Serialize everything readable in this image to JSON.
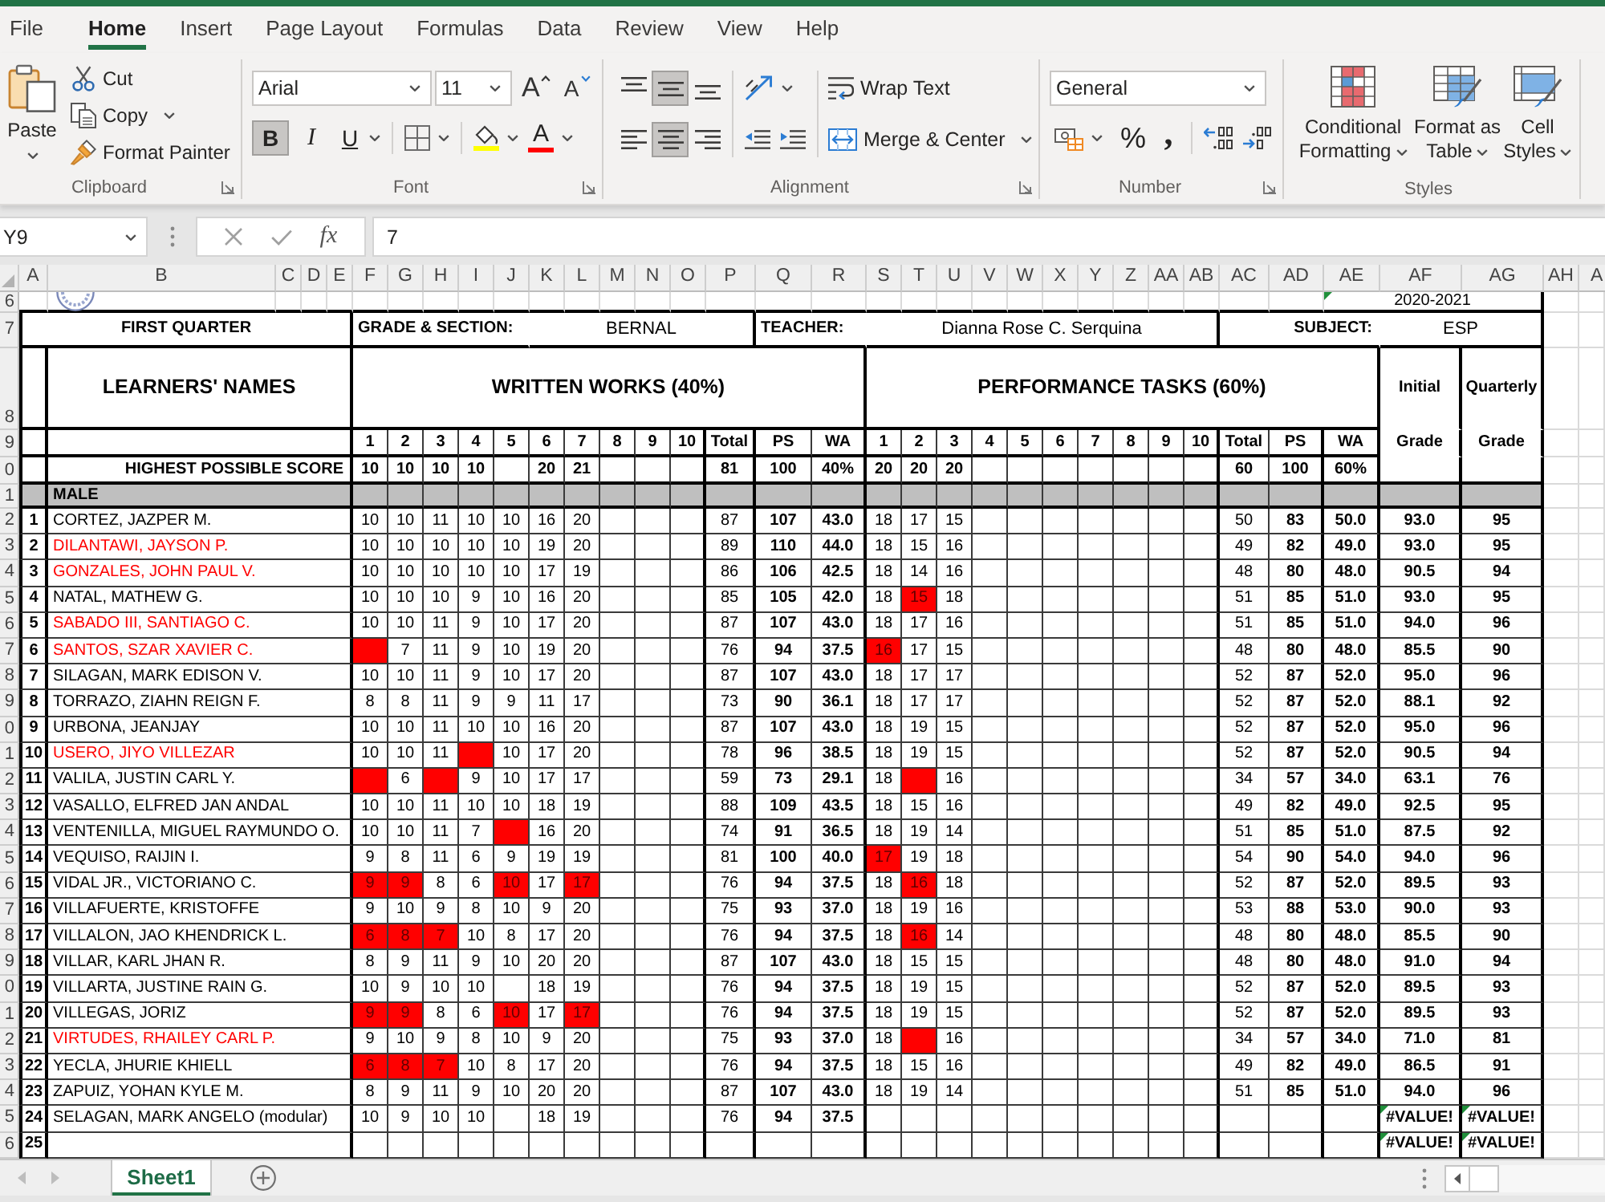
{
  "ribbon_tabs": [
    {
      "label": "File",
      "selected": false
    },
    {
      "label": "Home",
      "selected": true
    },
    {
      "label": "Insert",
      "selected": false
    },
    {
      "label": "Page Layout",
      "selected": false
    },
    {
      "label": "Formulas",
      "selected": false
    },
    {
      "label": "Data",
      "selected": false
    },
    {
      "label": "Review",
      "selected": false
    },
    {
      "label": "View",
      "selected": false
    },
    {
      "label": "Help",
      "selected": false
    }
  ],
  "ribbon": {
    "clipboard": {
      "title": "Clipboard",
      "paste": "Paste",
      "commands": [
        {
          "kind": "cut",
          "label": "Cut"
        },
        {
          "kind": "copy",
          "label": "Copy"
        },
        {
          "kind": "format_painter",
          "label": "Format Painter"
        }
      ]
    },
    "font": {
      "title": "Font",
      "font_name": "Arial",
      "font_size": "11",
      "grow": "A",
      "shrink": "A",
      "styles": [
        {
          "kind": "bold",
          "label": "B",
          "on": true
        },
        {
          "kind": "italic",
          "label": "I",
          "on": false
        },
        {
          "kind": "underline",
          "label": "U",
          "on": false
        }
      ],
      "fill": {
        "color": "#ffff00"
      },
      "font_color": {
        "label": "A",
        "color": "#ff0000"
      }
    },
    "alignment": {
      "title": "Alignment",
      "vertical": [
        {
          "kind": "top",
          "on": false
        },
        {
          "kind": "middle",
          "on": true
        },
        {
          "kind": "bottom",
          "on": false
        }
      ],
      "horizontal": [
        {
          "kind": "left",
          "on": false
        },
        {
          "kind": "center",
          "on": true
        },
        {
          "kind": "right",
          "on": false
        }
      ],
      "wrap_text": "Wrap Text",
      "merge": "Merge & Center"
    },
    "number": {
      "title": "Number",
      "format": "General",
      "percent": "%",
      "comma": ","
    },
    "styles": {
      "title": "Styles",
      "commands": [
        {
          "kind": "conditional_formatting",
          "label": "Conditional Formatting"
        },
        {
          "kind": "format_as_table",
          "label": "Format as Table"
        },
        {
          "kind": "cell_styles",
          "label": "Cell Styles"
        }
      ]
    }
  },
  "formula_bar": {
    "name_box": "Y9",
    "fx": "fx",
    "formula": "7"
  },
  "sheet": {
    "column_headers": [
      "A",
      "B",
      "C",
      "D",
      "E",
      "F",
      "G",
      "H",
      "I",
      "J",
      "K",
      "L",
      "M",
      "N",
      "O",
      "P",
      "Q",
      "R",
      "S",
      "T",
      "U",
      "V",
      "W",
      "X",
      "Y",
      "Z",
      "AA",
      "AB",
      "AC",
      "AD",
      "AE",
      "AF",
      "AG",
      "AH",
      "A"
    ],
    "row_headers": [
      "6",
      "7",
      "8",
      "9",
      "0",
      "1",
      "2",
      "3",
      "4",
      "5",
      "6",
      "7",
      "8",
      "9",
      "0",
      "1",
      "2",
      "3",
      "4",
      "5",
      "6",
      "7",
      "8",
      "9",
      "0",
      "1",
      "2",
      "3",
      "4",
      "5",
      "6"
    ],
    "school_year": {
      "text": "2020-2021",
      "error": true
    },
    "quarter": "FIRST QUARTER",
    "grade_section": {
      "label": "GRADE & SECTION:",
      "value": "BERNAL"
    },
    "teacher": {
      "label": "TEACHER:",
      "value": "Dianna Rose C. Serquina"
    },
    "subject": {
      "label": "SUBJECT:",
      "value": "ESP"
    },
    "names_heading": "LEARNERS' NAMES",
    "written_works": {
      "heading": "WRITTEN WORKS (40%)",
      "items": [
        "1",
        "2",
        "3",
        "4",
        "5",
        "6",
        "7",
        "8",
        "9",
        "10"
      ],
      "total": "Total",
      "ps": "PS",
      "wa": "WA"
    },
    "performance_tasks": {
      "heading": "PERFORMANCE TASKS (60%)",
      "items": [
        "1",
        "2",
        "3",
        "4",
        "5",
        "6",
        "7",
        "8",
        "9",
        "10"
      ],
      "total": "Total",
      "ps": "PS",
      "wa": "WA"
    },
    "initial_grade_heading": [
      "Initial",
      "Grade"
    ],
    "quarterly_grade_heading": [
      "Quarterly",
      "Grade"
    ],
    "highest_possible": {
      "label": "HIGHEST POSSIBLE SCORE",
      "ww": {
        "item_1": "10",
        "item_2": "10",
        "item_3": "10",
        "item_4": "10",
        "item_6": "20",
        "item_7": "21"
      },
      "ww_total": "81",
      "ww_ps": "100",
      "ww_wa": "40%",
      "pt": {
        "item_1": "20",
        "item_2": "20",
        "item_3": "20"
      },
      "pt_total": "60",
      "pt_ps": "100",
      "pt_wa": "60%"
    },
    "group_label": "MALE",
    "learners": [
      {
        "number": "1",
        "name": "CORTEZ, JAZPER M.",
        "color": "#000000",
        "ww": [
          {
            "score": "10",
            "highlighted": false
          },
          {
            "score": "10",
            "highlighted": false
          },
          {
            "score": "11",
            "highlighted": false
          },
          {
            "score": "10",
            "highlighted": false
          },
          {
            "score": "10",
            "highlighted": false
          },
          {
            "score": "16",
            "highlighted": false
          },
          {
            "score": "20",
            "highlighted": false
          }
        ],
        "ww_total": "87",
        "ww_ps": "107",
        "ww_wa": "43.0",
        "pt": [
          {
            "score": "18",
            "highlighted": false
          },
          {
            "score": "17",
            "highlighted": false
          },
          {
            "score": "15",
            "highlighted": false
          }
        ],
        "pt_total": "50",
        "pt_ps": "83",
        "pt_wa": "50.0",
        "initial_grade": "93.0",
        "quarterly_grade": "95",
        "grade_error": false
      },
      {
        "number": "2",
        "name": "DILANTAWI, JAYSON P.",
        "color": "#ff0000",
        "ww": [
          {
            "score": "10",
            "highlighted": false
          },
          {
            "score": "10",
            "highlighted": false
          },
          {
            "score": "10",
            "highlighted": false
          },
          {
            "score": "10",
            "highlighted": false
          },
          {
            "score": "10",
            "highlighted": false
          },
          {
            "score": "19",
            "highlighted": false
          },
          {
            "score": "20",
            "highlighted": false
          }
        ],
        "ww_total": "89",
        "ww_ps": "110",
        "ww_wa": "44.0",
        "pt": [
          {
            "score": "18",
            "highlighted": false
          },
          {
            "score": "15",
            "highlighted": false
          },
          {
            "score": "16",
            "highlighted": false
          }
        ],
        "pt_total": "49",
        "pt_ps": "82",
        "pt_wa": "49.0",
        "initial_grade": "93.0",
        "quarterly_grade": "95",
        "grade_error": false
      },
      {
        "number": "3",
        "name": "GONZALES, JOHN PAUL V.",
        "color": "#ff0000",
        "ww": [
          {
            "score": "10",
            "highlighted": false
          },
          {
            "score": "10",
            "highlighted": false
          },
          {
            "score": "10",
            "highlighted": false
          },
          {
            "score": "10",
            "highlighted": false
          },
          {
            "score": "10",
            "highlighted": false
          },
          {
            "score": "17",
            "highlighted": false
          },
          {
            "score": "19",
            "highlighted": false
          }
        ],
        "ww_total": "86",
        "ww_ps": "106",
        "ww_wa": "42.5",
        "pt": [
          {
            "score": "18",
            "highlighted": false
          },
          {
            "score": "14",
            "highlighted": false
          },
          {
            "score": "16",
            "highlighted": false
          }
        ],
        "pt_total": "48",
        "pt_ps": "80",
        "pt_wa": "48.0",
        "initial_grade": "90.5",
        "quarterly_grade": "94",
        "grade_error": false
      },
      {
        "number": "4",
        "name": "NATAL, MATHEW G.",
        "color": "#000000",
        "ww": [
          {
            "score": "10",
            "highlighted": false
          },
          {
            "score": "10",
            "highlighted": false
          },
          {
            "score": "10",
            "highlighted": false
          },
          {
            "score": "9",
            "highlighted": false
          },
          {
            "score": "10",
            "highlighted": false
          },
          {
            "score": "16",
            "highlighted": false
          },
          {
            "score": "20",
            "highlighted": false
          }
        ],
        "ww_total": "85",
        "ww_ps": "105",
        "ww_wa": "42.0",
        "pt": [
          {
            "score": "18",
            "highlighted": false
          },
          {
            "score": "15",
            "highlighted": true
          },
          {
            "score": "18",
            "highlighted": false
          }
        ],
        "pt_total": "51",
        "pt_ps": "85",
        "pt_wa": "51.0",
        "initial_grade": "93.0",
        "quarterly_grade": "95",
        "grade_error": false
      },
      {
        "number": "5",
        "name": "SABADO III, SANTIAGO C.",
        "color": "#ff0000",
        "ww": [
          {
            "score": "10",
            "highlighted": false
          },
          {
            "score": "10",
            "highlighted": false
          },
          {
            "score": "11",
            "highlighted": false
          },
          {
            "score": "9",
            "highlighted": false
          },
          {
            "score": "10",
            "highlighted": false
          },
          {
            "score": "17",
            "highlighted": false
          },
          {
            "score": "20",
            "highlighted": false
          }
        ],
        "ww_total": "87",
        "ww_ps": "107",
        "ww_wa": "43.0",
        "pt": [
          {
            "score": "18",
            "highlighted": false
          },
          {
            "score": "17",
            "highlighted": false
          },
          {
            "score": "16",
            "highlighted": false
          }
        ],
        "pt_total": "51",
        "pt_ps": "85",
        "pt_wa": "51.0",
        "initial_grade": "94.0",
        "quarterly_grade": "96",
        "grade_error": false
      },
      {
        "number": "6",
        "name": "SANTOS, SZAR XAVIER C.",
        "color": "#ff0000",
        "ww": [
          {
            "highlighted": true
          },
          {
            "score": "7",
            "highlighted": false
          },
          {
            "score": "11",
            "highlighted": false
          },
          {
            "score": "9",
            "highlighted": false
          },
          {
            "score": "10",
            "highlighted": false
          },
          {
            "score": "19",
            "highlighted": false
          },
          {
            "score": "20",
            "highlighted": false
          }
        ],
        "ww_total": "76",
        "ww_ps": "94",
        "ww_wa": "37.5",
        "pt": [
          {
            "score": "16",
            "highlighted": true
          },
          {
            "score": "17",
            "highlighted": false
          },
          {
            "score": "15",
            "highlighted": false
          }
        ],
        "pt_total": "48",
        "pt_ps": "80",
        "pt_wa": "48.0",
        "initial_grade": "85.5",
        "quarterly_grade": "90",
        "grade_error": false
      },
      {
        "number": "7",
        "name": "SILAGAN, MARK EDISON V.",
        "color": "#000000",
        "ww": [
          {
            "score": "10",
            "highlighted": false
          },
          {
            "score": "10",
            "highlighted": false
          },
          {
            "score": "11",
            "highlighted": false
          },
          {
            "score": "9",
            "highlighted": false
          },
          {
            "score": "10",
            "highlighted": false
          },
          {
            "score": "17",
            "highlighted": false
          },
          {
            "score": "20",
            "highlighted": false
          }
        ],
        "ww_total": "87",
        "ww_ps": "107",
        "ww_wa": "43.0",
        "pt": [
          {
            "score": "18",
            "highlighted": false
          },
          {
            "score": "17",
            "highlighted": false
          },
          {
            "score": "17",
            "highlighted": false
          }
        ],
        "pt_total": "52",
        "pt_ps": "87",
        "pt_wa": "52.0",
        "initial_grade": "95.0",
        "quarterly_grade": "96",
        "grade_error": false
      },
      {
        "number": "8",
        "name": "TORRAZO, ZIAHN REIGN F.",
        "color": "#000000",
        "ww": [
          {
            "score": "8",
            "highlighted": false
          },
          {
            "score": "8",
            "highlighted": false
          },
          {
            "score": "11",
            "highlighted": false
          },
          {
            "score": "9",
            "highlighted": false
          },
          {
            "score": "9",
            "highlighted": false
          },
          {
            "score": "11",
            "highlighted": false
          },
          {
            "score": "17",
            "highlighted": false
          }
        ],
        "ww_total": "73",
        "ww_ps": "90",
        "ww_wa": "36.1",
        "pt": [
          {
            "score": "18",
            "highlighted": false
          },
          {
            "score": "17",
            "highlighted": false
          },
          {
            "score": "17",
            "highlighted": false
          }
        ],
        "pt_total": "52",
        "pt_ps": "87",
        "pt_wa": "52.0",
        "initial_grade": "88.1",
        "quarterly_grade": "92",
        "grade_error": false
      },
      {
        "number": "9",
        "name": "URBONA, JEANJAY",
        "color": "#000000",
        "ww": [
          {
            "score": "10",
            "highlighted": false
          },
          {
            "score": "10",
            "highlighted": false
          },
          {
            "score": "11",
            "highlighted": false
          },
          {
            "score": "10",
            "highlighted": false
          },
          {
            "score": "10",
            "highlighted": false
          },
          {
            "score": "16",
            "highlighted": false
          },
          {
            "score": "20",
            "highlighted": false
          }
        ],
        "ww_total": "87",
        "ww_ps": "107",
        "ww_wa": "43.0",
        "pt": [
          {
            "score": "18",
            "highlighted": false
          },
          {
            "score": "19",
            "highlighted": false
          },
          {
            "score": "15",
            "highlighted": false
          }
        ],
        "pt_total": "52",
        "pt_ps": "87",
        "pt_wa": "52.0",
        "initial_grade": "95.0",
        "quarterly_grade": "96",
        "grade_error": false
      },
      {
        "number": "10",
        "name": "USERO, JIYO VILLEZAR",
        "color": "#ff0000",
        "ww": [
          {
            "score": "10",
            "highlighted": false
          },
          {
            "score": "10",
            "highlighted": false
          },
          {
            "score": "11",
            "highlighted": false
          },
          {
            "highlighted": true
          },
          {
            "score": "10",
            "highlighted": false
          },
          {
            "score": "17",
            "highlighted": false
          },
          {
            "score": "20",
            "highlighted": false
          }
        ],
        "ww_total": "78",
        "ww_ps": "96",
        "ww_wa": "38.5",
        "pt": [
          {
            "score": "18",
            "highlighted": false
          },
          {
            "score": "19",
            "highlighted": false
          },
          {
            "score": "15",
            "highlighted": false
          }
        ],
        "pt_total": "52",
        "pt_ps": "87",
        "pt_wa": "52.0",
        "initial_grade": "90.5",
        "quarterly_grade": "94",
        "grade_error": false
      },
      {
        "number": "11",
        "name": "VALILA, JUSTIN CARL Y.",
        "color": "#000000",
        "ww": [
          {
            "highlighted": true
          },
          {
            "score": "6",
            "highlighted": false
          },
          {
            "highlighted": true
          },
          {
            "score": "9",
            "highlighted": false
          },
          {
            "score": "10",
            "highlighted": false
          },
          {
            "score": "17",
            "highlighted": false
          },
          {
            "score": "17",
            "highlighted": false
          }
        ],
        "ww_total": "59",
        "ww_ps": "73",
        "ww_wa": "29.1",
        "pt": [
          {
            "score": "18",
            "highlighted": false
          },
          {
            "highlighted": true
          },
          {
            "score": "16",
            "highlighted": false
          }
        ],
        "pt_total": "34",
        "pt_ps": "57",
        "pt_wa": "34.0",
        "initial_grade": "63.1",
        "quarterly_grade": "76",
        "grade_error": false
      },
      {
        "number": "12",
        "name": "VASALLO, ELFRED JAN ANDAL",
        "color": "#000000",
        "ww": [
          {
            "score": "10",
            "highlighted": false
          },
          {
            "score": "10",
            "highlighted": false
          },
          {
            "score": "11",
            "highlighted": false
          },
          {
            "score": "10",
            "highlighted": false
          },
          {
            "score": "10",
            "highlighted": false
          },
          {
            "score": "18",
            "highlighted": false
          },
          {
            "score": "19",
            "highlighted": false
          }
        ],
        "ww_total": "88",
        "ww_ps": "109",
        "ww_wa": "43.5",
        "pt": [
          {
            "score": "18",
            "highlighted": false
          },
          {
            "score": "15",
            "highlighted": false
          },
          {
            "score": "16",
            "highlighted": false
          }
        ],
        "pt_total": "49",
        "pt_ps": "82",
        "pt_wa": "49.0",
        "initial_grade": "92.5",
        "quarterly_grade": "95",
        "grade_error": false
      },
      {
        "number": "13",
        "name": "VENTENILLA, MIGUEL RAYMUNDO O.",
        "color": "#000000",
        "ww": [
          {
            "score": "10",
            "highlighted": false
          },
          {
            "score": "10",
            "highlighted": false
          },
          {
            "score": "11",
            "highlighted": false
          },
          {
            "score": "7",
            "highlighted": false
          },
          {
            "highlighted": true
          },
          {
            "score": "16",
            "highlighted": false
          },
          {
            "score": "20",
            "highlighted": false
          }
        ],
        "ww_total": "74",
        "ww_ps": "91",
        "ww_wa": "36.5",
        "pt": [
          {
            "score": "18",
            "highlighted": false
          },
          {
            "score": "19",
            "highlighted": false
          },
          {
            "score": "14",
            "highlighted": false
          }
        ],
        "pt_total": "51",
        "pt_ps": "85",
        "pt_wa": "51.0",
        "initial_grade": "87.5",
        "quarterly_grade": "92",
        "grade_error": false
      },
      {
        "number": "14",
        "name": "VEQUISO, RAIJIN I.",
        "color": "#000000",
        "ww": [
          {
            "score": "9",
            "highlighted": false
          },
          {
            "score": "8",
            "highlighted": false
          },
          {
            "score": "11",
            "highlighted": false
          },
          {
            "score": "6",
            "highlighted": false
          },
          {
            "score": "9",
            "highlighted": false
          },
          {
            "score": "19",
            "highlighted": false
          },
          {
            "score": "19",
            "highlighted": false
          }
        ],
        "ww_total": "81",
        "ww_ps": "100",
        "ww_wa": "40.0",
        "pt": [
          {
            "score": "17",
            "highlighted": true
          },
          {
            "score": "19",
            "highlighted": false
          },
          {
            "score": "18",
            "highlighted": false
          }
        ],
        "pt_total": "54",
        "pt_ps": "90",
        "pt_wa": "54.0",
        "initial_grade": "94.0",
        "quarterly_grade": "96",
        "grade_error": false
      },
      {
        "number": "15",
        "name": "VIDAL JR., VICTORIANO C.",
        "color": "#000000",
        "ww": [
          {
            "score": "9",
            "highlighted": true
          },
          {
            "score": "9",
            "highlighted": true
          },
          {
            "score": "8",
            "highlighted": false
          },
          {
            "score": "6",
            "highlighted": false
          },
          {
            "score": "10",
            "highlighted": true
          },
          {
            "score": "17",
            "highlighted": false
          },
          {
            "score": "17",
            "highlighted": true
          }
        ],
        "ww_total": "76",
        "ww_ps": "94",
        "ww_wa": "37.5",
        "pt": [
          {
            "score": "18",
            "highlighted": false
          },
          {
            "score": "16",
            "highlighted": true
          },
          {
            "score": "18",
            "highlighted": false
          }
        ],
        "pt_total": "52",
        "pt_ps": "87",
        "pt_wa": "52.0",
        "initial_grade": "89.5",
        "quarterly_grade": "93",
        "grade_error": false
      },
      {
        "number": "16",
        "name": "VILLAFUERTE, KRISTOFFE",
        "color": "#000000",
        "ww": [
          {
            "score": "9",
            "highlighted": false
          },
          {
            "score": "10",
            "highlighted": false
          },
          {
            "score": "9",
            "highlighted": false
          },
          {
            "score": "8",
            "highlighted": false
          },
          {
            "score": "10",
            "highlighted": false
          },
          {
            "score": "9",
            "highlighted": false
          },
          {
            "score": "20",
            "highlighted": false
          }
        ],
        "ww_total": "75",
        "ww_ps": "93",
        "ww_wa": "37.0",
        "pt": [
          {
            "score": "18",
            "highlighted": false
          },
          {
            "score": "19",
            "highlighted": false
          },
          {
            "score": "16",
            "highlighted": false
          }
        ],
        "pt_total": "53",
        "pt_ps": "88",
        "pt_wa": "53.0",
        "initial_grade": "90.0",
        "quarterly_grade": "93",
        "grade_error": false
      },
      {
        "number": "17",
        "name": "VILLALON, JAO KHENDRICK L.",
        "color": "#000000",
        "ww": [
          {
            "score": "6",
            "highlighted": true
          },
          {
            "score": "8",
            "highlighted": true
          },
          {
            "score": "7",
            "highlighted": true
          },
          {
            "score": "10",
            "highlighted": false
          },
          {
            "score": "8",
            "highlighted": false
          },
          {
            "score": "17",
            "highlighted": false
          },
          {
            "score": "20",
            "highlighted": false
          }
        ],
        "ww_total": "76",
        "ww_ps": "94",
        "ww_wa": "37.5",
        "pt": [
          {
            "score": "18",
            "highlighted": false
          },
          {
            "score": "16",
            "highlighted": true
          },
          {
            "score": "14",
            "highlighted": false
          }
        ],
        "pt_total": "48",
        "pt_ps": "80",
        "pt_wa": "48.0",
        "initial_grade": "85.5",
        "quarterly_grade": "90",
        "grade_error": false
      },
      {
        "number": "18",
        "name": "VILLAR, KARL JHAN R.",
        "color": "#000000",
        "ww": [
          {
            "score": "8",
            "highlighted": false
          },
          {
            "score": "9",
            "highlighted": false
          },
          {
            "score": "11",
            "highlighted": false
          },
          {
            "score": "9",
            "highlighted": false
          },
          {
            "score": "10",
            "highlighted": false
          },
          {
            "score": "20",
            "highlighted": false
          },
          {
            "score": "20",
            "highlighted": false
          }
        ],
        "ww_total": "87",
        "ww_ps": "107",
        "ww_wa": "43.0",
        "pt": [
          {
            "score": "18",
            "highlighted": false
          },
          {
            "score": "15",
            "highlighted": false
          },
          {
            "score": "15",
            "highlighted": false
          }
        ],
        "pt_total": "48",
        "pt_ps": "80",
        "pt_wa": "48.0",
        "initial_grade": "91.0",
        "quarterly_grade": "94",
        "grade_error": false
      },
      {
        "number": "19",
        "name": "VILLARTA, JUSTINE RAIN G.",
        "color": "#000000",
        "ww": [
          {
            "score": "10",
            "highlighted": false
          },
          {
            "score": "9",
            "highlighted": false
          },
          {
            "score": "10",
            "highlighted": false
          },
          {
            "score": "10",
            "highlighted": false
          },
          {
            "highlighted": false
          },
          {
            "score": "18",
            "highlighted": false
          },
          {
            "score": "19",
            "highlighted": false
          }
        ],
        "ww_total": "76",
        "ww_ps": "94",
        "ww_wa": "37.5",
        "pt": [
          {
            "score": "18",
            "highlighted": false
          },
          {
            "score": "19",
            "highlighted": false
          },
          {
            "score": "15",
            "highlighted": false
          }
        ],
        "pt_total": "52",
        "pt_ps": "87",
        "pt_wa": "52.0",
        "initial_grade": "89.5",
        "quarterly_grade": "93",
        "grade_error": false
      },
      {
        "number": "20",
        "name": "VILLEGAS, JORIZ",
        "color": "#000000",
        "ww": [
          {
            "score": "9",
            "highlighted": true
          },
          {
            "score": "9",
            "highlighted": true
          },
          {
            "score": "8",
            "highlighted": false
          },
          {
            "score": "6",
            "highlighted": false
          },
          {
            "score": "10",
            "highlighted": true
          },
          {
            "score": "17",
            "highlighted": false
          },
          {
            "score": "17",
            "highlighted": true
          }
        ],
        "ww_total": "76",
        "ww_ps": "94",
        "ww_wa": "37.5",
        "pt": [
          {
            "score": "18",
            "highlighted": false
          },
          {
            "score": "19",
            "highlighted": false
          },
          {
            "score": "15",
            "highlighted": false
          }
        ],
        "pt_total": "52",
        "pt_ps": "87",
        "pt_wa": "52.0",
        "initial_grade": "89.5",
        "quarterly_grade": "93",
        "grade_error": false
      },
      {
        "number": "21",
        "name": "VIRTUDES, RHAILEY CARL P.",
        "color": "#ff0000",
        "ww": [
          {
            "score": "9",
            "highlighted": false
          },
          {
            "score": "10",
            "highlighted": false
          },
          {
            "score": "9",
            "highlighted": false
          },
          {
            "score": "8",
            "highlighted": false
          },
          {
            "score": "10",
            "highlighted": false
          },
          {
            "score": "9",
            "highlighted": false
          },
          {
            "score": "20",
            "highlighted": false
          }
        ],
        "ww_total": "75",
        "ww_ps": "93",
        "ww_wa": "37.0",
        "pt": [
          {
            "score": "18",
            "highlighted": false
          },
          {
            "highlighted": true
          },
          {
            "score": "16",
            "highlighted": false
          }
        ],
        "pt_total": "34",
        "pt_ps": "57",
        "pt_wa": "34.0",
        "initial_grade": "71.0",
        "quarterly_grade": "81",
        "grade_error": false
      },
      {
        "number": "22",
        "name": "YECLA, JHURIE KHIELL",
        "color": "#000000",
        "ww": [
          {
            "score": "6",
            "highlighted": true
          },
          {
            "score": "8",
            "highlighted": true
          },
          {
            "score": "7",
            "highlighted": true
          },
          {
            "score": "10",
            "highlighted": false
          },
          {
            "score": "8",
            "highlighted": false
          },
          {
            "score": "17",
            "highlighted": false
          },
          {
            "score": "20",
            "highlighted": false
          }
        ],
        "ww_total": "76",
        "ww_ps": "94",
        "ww_wa": "37.5",
        "pt": [
          {
            "score": "18",
            "highlighted": false
          },
          {
            "score": "15",
            "highlighted": false
          },
          {
            "score": "16",
            "highlighted": false
          }
        ],
        "pt_total": "49",
        "pt_ps": "82",
        "pt_wa": "49.0",
        "initial_grade": "86.5",
        "quarterly_grade": "91",
        "grade_error": false
      },
      {
        "number": "23",
        "name": "ZAPUIZ, YOHAN KYLE M.",
        "color": "#000000",
        "ww": [
          {
            "score": "8",
            "highlighted": false
          },
          {
            "score": "9",
            "highlighted": false
          },
          {
            "score": "11",
            "highlighted": false
          },
          {
            "score": "9",
            "highlighted": false
          },
          {
            "score": "10",
            "highlighted": false
          },
          {
            "score": "20",
            "highlighted": false
          },
          {
            "score": "20",
            "highlighted": false
          }
        ],
        "ww_total": "87",
        "ww_ps": "107",
        "ww_wa": "43.0",
        "pt": [
          {
            "score": "18",
            "highlighted": false
          },
          {
            "score": "19",
            "highlighted": false
          },
          {
            "score": "14",
            "highlighted": false
          }
        ],
        "pt_total": "51",
        "pt_ps": "85",
        "pt_wa": "51.0",
        "initial_grade": "94.0",
        "quarterly_grade": "96",
        "grade_error": false
      },
      {
        "number": "24",
        "name": "SELAGAN, MARK ANGELO (modular)",
        "color": "#000000",
        "ww": [
          {
            "score": "10",
            "highlighted": false
          },
          {
            "score": "9",
            "highlighted": false
          },
          {
            "score": "10",
            "highlighted": false
          },
          {
            "score": "10",
            "highlighted": false
          },
          {
            "highlighted": false
          },
          {
            "score": "18",
            "highlighted": false
          },
          {
            "score": "19",
            "highlighted": false
          }
        ],
        "ww_total": "76",
        "ww_ps": "94",
        "ww_wa": "37.5",
        "initial_grade": "#VALUE!",
        "quarterly_grade": "#VALUE!",
        "grade_error": true
      },
      {
        "number": "25",
        "initial_grade": "#VALUE!",
        "quarterly_grade": "#VALUE!",
        "grade_error": true
      }
    ]
  },
  "sheet_tabs": [
    {
      "label": "Sheet1",
      "selected": true
    }
  ]
}
